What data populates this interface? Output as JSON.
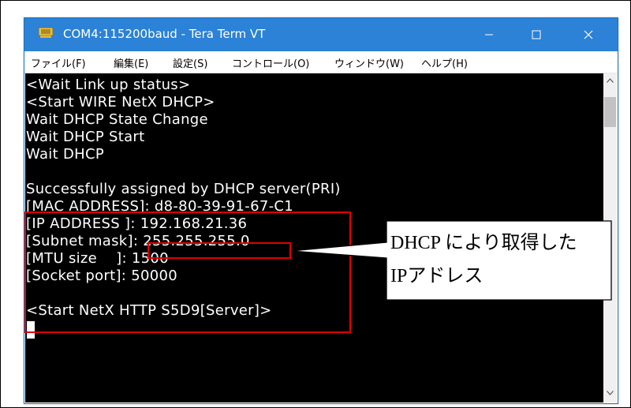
{
  "window": {
    "title": "COM4:115200baud - Tera Term VT"
  },
  "menu": {
    "items": [
      {
        "label": "ファイル(F)"
      },
      {
        "label": "編集(E)"
      },
      {
        "label": "設定(S)"
      },
      {
        "label": "コントロール(O)"
      },
      {
        "label": "ウィンドウ(W)"
      },
      {
        "label": "ヘルプ(H)"
      }
    ]
  },
  "terminal": {
    "lines": [
      "<Wait Link up status>",
      "<Start WIRE NetX DHCP>",
      "Wait DHCP State Change",
      "Wait DHCP Start",
      "Wait DHCP",
      "",
      "Successfully assigned by DHCP server(PRI)",
      "[MAC ADDRESS]: d8-80-39-91-67-C1",
      "[IP ADDRESS ]: 192.168.21.36",
      "[Subnet mask]: 255.255.255.0",
      "[MTU size    ]: 1500",
      "[Socket port]: 50000",
      "",
      "<Start NetX HTTP S5D9[Server]>"
    ]
  },
  "callout": {
    "line1": "DHCP により取得した",
    "line2": "IPアドレス"
  },
  "colors": {
    "titlebar": "#2b82d6",
    "terminal_bg": "#000000",
    "terminal_fg": "#ffffff",
    "highlight": "#e00000"
  },
  "icons": {
    "app": "tera-term-icon",
    "minimize": "minimize-icon",
    "maximize": "maximize-icon",
    "close": "close-icon"
  }
}
